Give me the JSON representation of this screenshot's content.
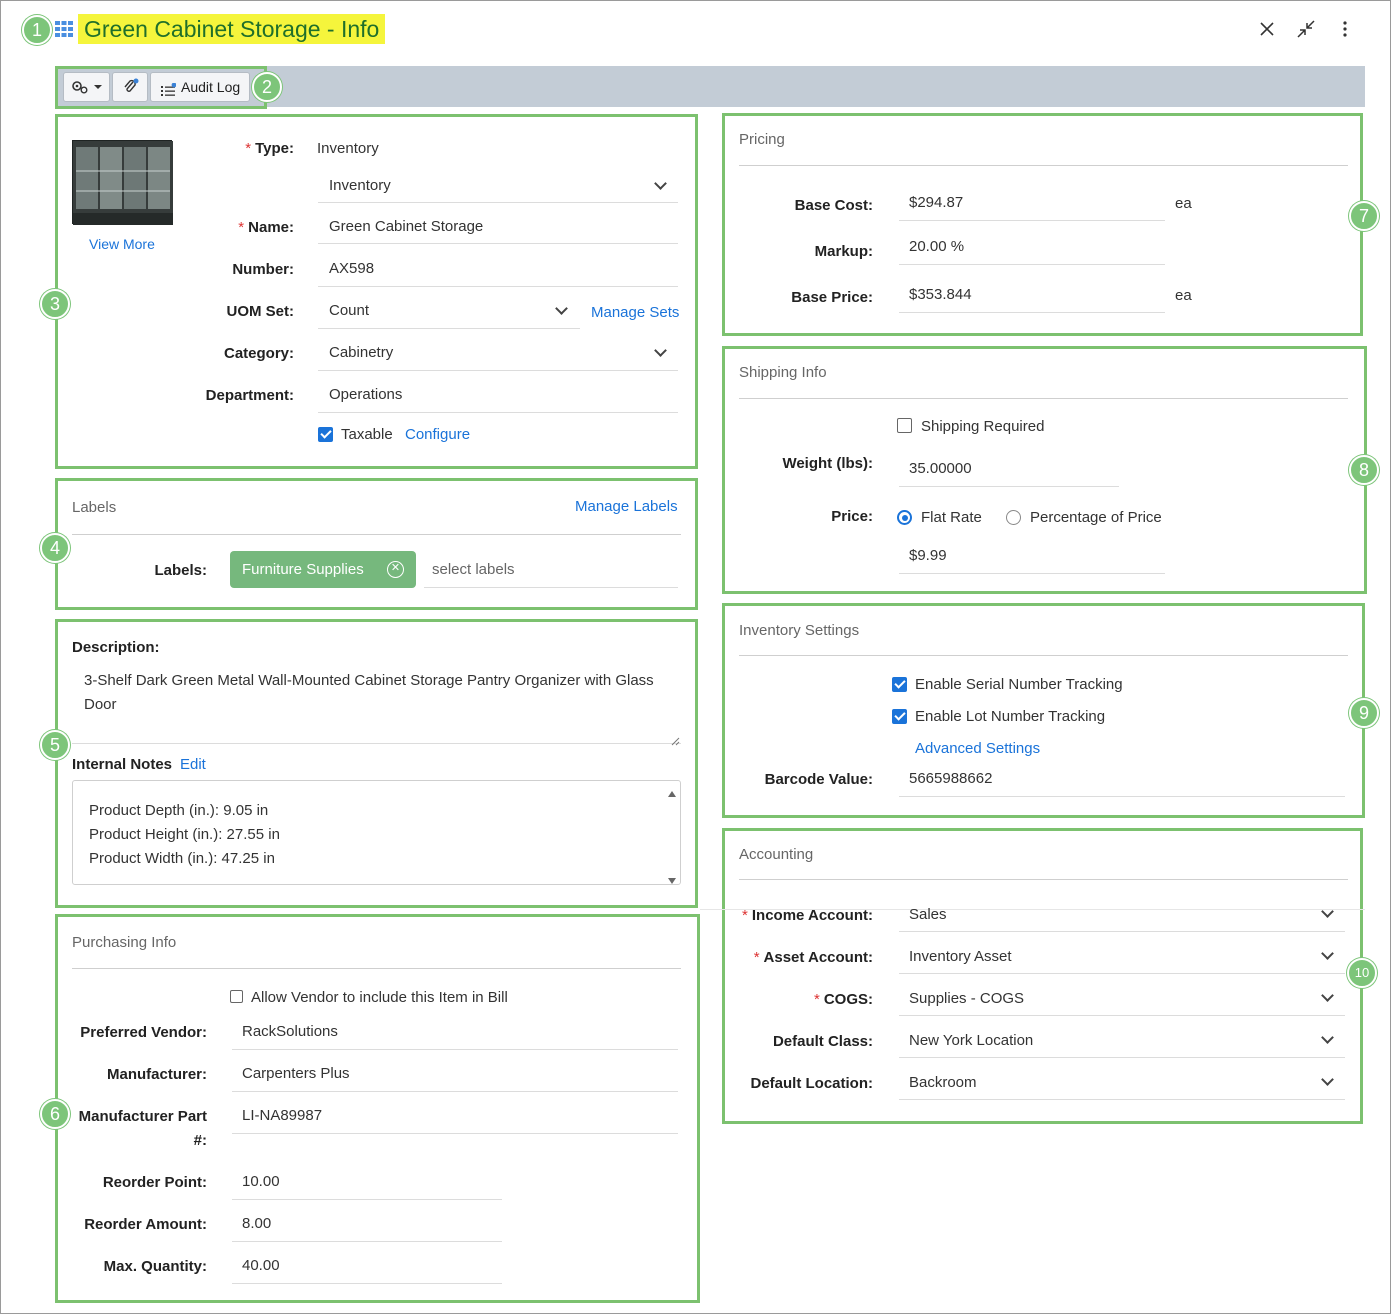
{
  "header": {
    "title": "Green Cabinet Storage - Info"
  },
  "annotations": [
    "1",
    "2",
    "3",
    "4",
    "5",
    "6",
    "7",
    "8",
    "9",
    "10"
  ],
  "toolbar": {
    "audit_log_label": "Audit Log"
  },
  "item": {
    "view_more": "View More",
    "type_label": "Type:",
    "type_value": "Inventory",
    "type_select": "Inventory",
    "name_label": "Name:",
    "name_value": "Green Cabinet Storage",
    "number_label": "Number:",
    "number_value": "AX598",
    "uom_label": "UOM Set:",
    "uom_value": "Count",
    "manage_sets": "Manage Sets",
    "category_label": "Category:",
    "category_value": "Cabinetry",
    "department_label": "Department:",
    "department_value": "Operations",
    "taxable_label": "Taxable",
    "taxable_checked": true,
    "configure": "Configure"
  },
  "labels_section": {
    "title": "Labels",
    "manage_labels": "Manage Labels",
    "labels_label": "Labels:",
    "chip": "Furniture Supplies",
    "placeholder": "select labels"
  },
  "description_section": {
    "description_label": "Description:",
    "description_value": "3-Shelf Dark Green Metal Wall-Mounted Cabinet Storage Pantry Organizer with Glass Door",
    "internal_notes_label": "Internal Notes",
    "edit": "Edit",
    "notes": [
      "Product Depth (in.): 9.05 in",
      "Product Height (in.): 27.55 in",
      "Product Width (in.): 47.25 in"
    ]
  },
  "purchasing": {
    "title": "Purchasing Info",
    "allow_vendor": "Allow Vendor to include this Item in Bill",
    "preferred_vendor_label": "Preferred Vendor:",
    "preferred_vendor": "RackSolutions",
    "manufacturer_label": "Manufacturer:",
    "manufacturer": "Carpenters Plus",
    "mfr_part_label_1": "Manufacturer Part",
    "mfr_part_label_2": "#:",
    "mfr_part": "LI-NA89987",
    "reorder_point_label": "Reorder Point:",
    "reorder_point": "10.00",
    "reorder_amount_label": "Reorder Amount:",
    "reorder_amount": "8.00",
    "max_quantity_label": "Max. Quantity:",
    "max_quantity": "40.00"
  },
  "pricing": {
    "title": "Pricing",
    "base_cost_label": "Base Cost:",
    "base_cost": "$294.87",
    "base_cost_unit": "ea",
    "markup_label": "Markup:",
    "markup": "20.00 %",
    "base_price_label": "Base Price:",
    "base_price": "$353.844",
    "base_price_unit": "ea"
  },
  "shipping": {
    "title": "Shipping Info",
    "shipping_required": "Shipping Required",
    "weight_label": "Weight (lbs):",
    "weight": "35.00000",
    "price_label": "Price:",
    "flat_rate": "Flat Rate",
    "percentage": "Percentage of Price",
    "price_value": "$9.99"
  },
  "inventory_settings": {
    "title": "Inventory Settings",
    "serial": "Enable Serial Number Tracking",
    "lot": "Enable Lot Number Tracking",
    "advanced": "Advanced Settings",
    "barcode_label": "Barcode Value:",
    "barcode": "5665988662"
  },
  "accounting": {
    "title": "Accounting",
    "income_label": "Income Account:",
    "income": "Sales",
    "asset_label": "Asset Account:",
    "asset": "Inventory Asset",
    "cogs_label": "COGS:",
    "cogs": "Supplies - COGS",
    "class_label": "Default Class:",
    "class": "New York Location",
    "location_label": "Default Location:",
    "location": "Backroom"
  },
  "colors": {
    "accent": "#1a73d9",
    "annotation_green": "#7cc16f",
    "title_highlight": "#f5f53c",
    "toolbar_strip": "#c3ccd6"
  }
}
